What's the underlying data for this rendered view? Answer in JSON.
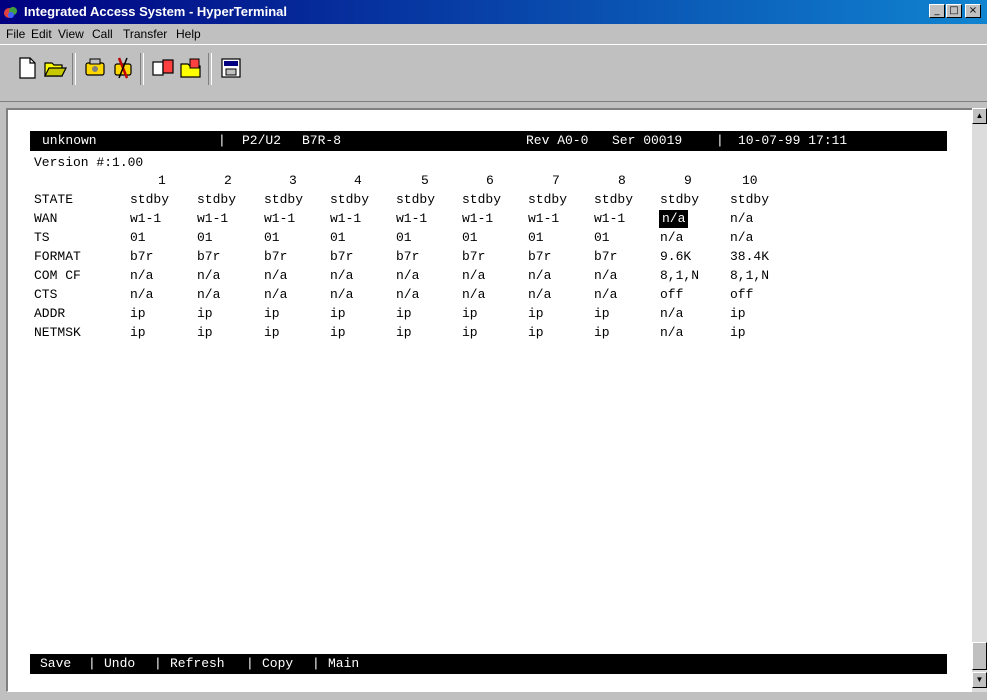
{
  "window": {
    "title": "Integrated Access System - HyperTerminal",
    "minimize_glyph": "_",
    "maximize_glyph": "□",
    "close_glyph": "×"
  },
  "menu": [
    "File",
    "Edit",
    "View",
    "Call",
    "Transfer",
    "Help"
  ],
  "toolbar_icons": [
    "new-icon",
    "open-icon",
    "connect-icon",
    "disconnect-icon",
    "send-icon",
    "receive-icon",
    "properties-icon"
  ],
  "terminal": {
    "header": {
      "name": "unknown",
      "sep1": "|",
      "slot": "P2/U2",
      "model": "B7R-8",
      "rev": "Rev A0-0",
      "ser": "Ser 00019",
      "sep2": "|",
      "datetime": "10-07-99 17:11"
    },
    "version": "Version #:1.00",
    "columns": [
      "1",
      "2",
      "3",
      "4",
      "5",
      "6",
      "7",
      "8",
      "9",
      "10"
    ],
    "rows": [
      {
        "label": "STATE",
        "values": [
          "stdby",
          "stdby",
          "stdby",
          "stdby",
          "stdby",
          "stdby",
          "stdby",
          "stdby",
          "stdby",
          "stdby"
        ]
      },
      {
        "label": "WAN",
        "values": [
          "w1-1",
          "w1-1",
          "w1-1",
          "w1-1",
          "w1-1",
          "w1-1",
          "w1-1",
          "w1-1",
          "n/a",
          "n/a"
        ]
      },
      {
        "label": "TS",
        "values": [
          "01",
          "01",
          "01",
          "01",
          "01",
          "01",
          "01",
          "01",
          "n/a",
          "n/a"
        ]
      },
      {
        "label": "FORMAT",
        "values": [
          "b7r",
          "b7r",
          "b7r",
          "b7r",
          "b7r",
          "b7r",
          "b7r",
          "b7r",
          "9.6K",
          "38.4K"
        ]
      },
      {
        "label": "COM CF",
        "values": [
          "n/a",
          "n/a",
          "n/a",
          "n/a",
          "n/a",
          "n/a",
          "n/a",
          "n/a",
          "8,1,N",
          "8,1,N"
        ]
      },
      {
        "label": "CTS",
        "values": [
          "n/a",
          "n/a",
          "n/a",
          "n/a",
          "n/a",
          "n/a",
          "n/a",
          "n/a",
          "off",
          "off"
        ]
      },
      {
        "label": "ADDR",
        "values": [
          "ip",
          "ip",
          "ip",
          "ip",
          "ip",
          "ip",
          "ip",
          "ip",
          "n/a",
          "ip"
        ]
      },
      {
        "label": "NETMSK",
        "values": [
          "ip",
          "ip",
          "ip",
          "ip",
          "ip",
          "ip",
          "ip",
          "ip",
          "n/a",
          "ip"
        ]
      }
    ],
    "footer": {
      "save": "Save",
      "undo": "Undo",
      "refresh": "Refresh",
      "copy": "Copy",
      "main": "Main",
      "sep": "|"
    }
  },
  "scrollbar": {
    "up_glyph": "▲",
    "down_glyph": "▼"
  }
}
